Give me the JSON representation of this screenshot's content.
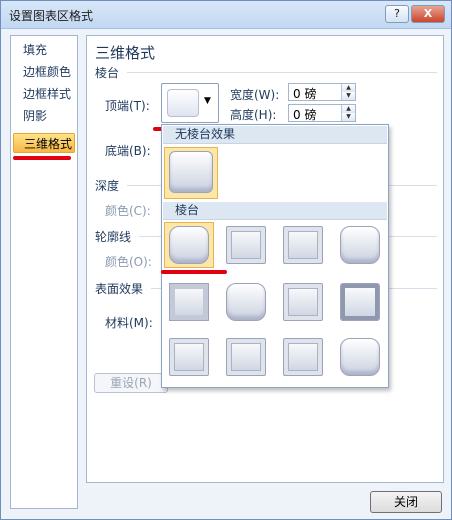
{
  "window": {
    "title": "设置图表区格式",
    "help_label": "?",
    "close_label": "X"
  },
  "nav": {
    "items": [
      {
        "label": "填充"
      },
      {
        "label": "边框颜色"
      },
      {
        "label": "边框样式"
      },
      {
        "label": "阴影"
      },
      {
        "label": "三维格式"
      }
    ],
    "selected_index": 4
  },
  "panel": {
    "title": "三维格式",
    "bevel_section": "棱台",
    "top_label": "顶端(T):",
    "bottom_label": "底端(B):",
    "width_label": "宽度(W):",
    "width_value": "0 磅",
    "height_label": "高度(H):",
    "height_value": "0 磅",
    "depth_section": "深度",
    "depth_color_label": "颜色(C):",
    "contour_section": "轮廓线",
    "contour_color_label": "颜色(O):",
    "surface_section": "表面效果",
    "material_label": "材料(M):",
    "reset_label": "重设(R)"
  },
  "popup": {
    "no_bevel_header": "无棱台效果",
    "bevel_header": "棱台"
  },
  "footer": {
    "close_label": "关闭"
  },
  "colors": {
    "accent_selected": "#f8b745",
    "annotation_red": "#e00010"
  }
}
